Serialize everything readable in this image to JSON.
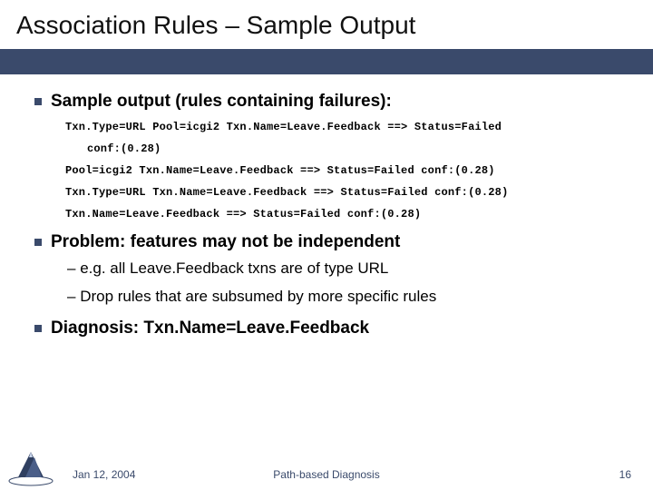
{
  "title": "Association Rules – Sample Output",
  "bullets": {
    "sample": {
      "heading": "Sample output (rules containing failures):",
      "rules": {
        "r1a": "Txn.Type=URL Pool=icgi2 Txn.Name=Leave.Feedback ==> Status=Failed",
        "r1b": "conf:(0.28)",
        "r2": "Pool=icgi2 Txn.Name=Leave.Feedback ==> Status=Failed conf:(0.28)",
        "r3": "Txn.Type=URL Txn.Name=Leave.Feedback ==> Status=Failed conf:(0.28)",
        "r4": "Txn.Name=Leave.Feedback ==> Status=Failed conf:(0.28)"
      }
    },
    "problem": {
      "heading": "Problem: features may not be independent",
      "sub": {
        "s1": "e.g. all Leave.Feedback txns are of type URL",
        "s2": "Drop rules that are subsumed by more specific rules"
      }
    },
    "diagnosis": {
      "heading": "Diagnosis: Txn.Name=Leave.Feedback"
    }
  },
  "footer": {
    "date": "Jan 12, 2004",
    "center": "Path-based Diagnosis",
    "page": "16"
  }
}
